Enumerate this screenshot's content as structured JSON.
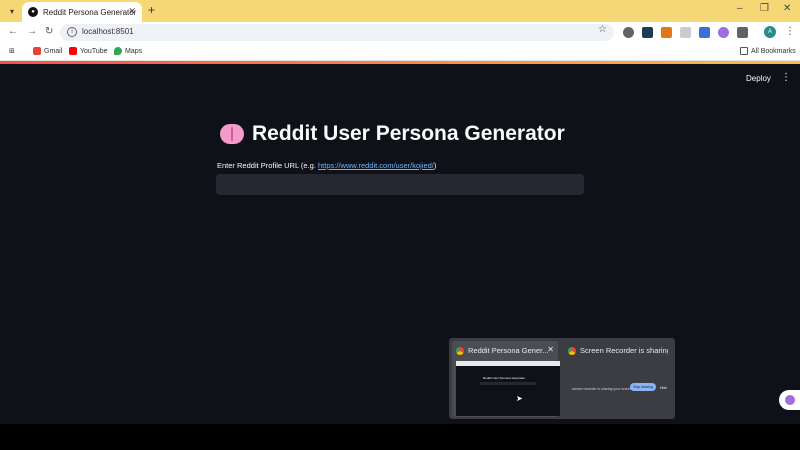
{
  "browser": {
    "tab_title": "Reddit Persona Generator",
    "tab_close": "✕",
    "new_tab": "+",
    "url": "localhost:8501",
    "bookmarks": [
      "Gmail",
      "YouTube",
      "Maps"
    ],
    "all_bookmarks": "All Bookmarks",
    "profile_initial": "A"
  },
  "app": {
    "deploy_label": "Deploy",
    "title": "Reddit User Persona Generator",
    "input_label_prefix": "Enter Reddit Profile URL (e.g. ",
    "input_label_link": "https://www.reddit.com/user/kojied/",
    "input_label_suffix": ")",
    "input_value": ""
  },
  "screen_share": {
    "card1_title": "Reddit Persona Gener...",
    "card2_title": "Screen Recorder is sharing y...",
    "thumb_title": "Reddit User Persona Generator",
    "thumb2_text": "screen recorder is sharing your screen",
    "stop_sharing": "Stop sharing",
    "hide": "Hide"
  },
  "colors": {
    "app_bg": "#0e1117",
    "tabstrip_bg": "#f6d776",
    "input_bg": "#262730",
    "link": "#6db4ff"
  }
}
